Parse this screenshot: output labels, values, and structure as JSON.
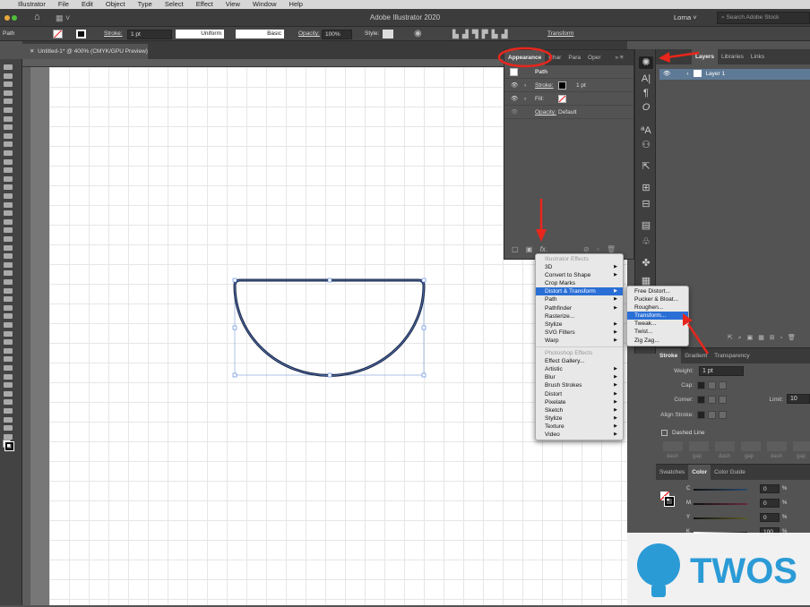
{
  "menubar": [
    "Illustrator",
    "File",
    "Edit",
    "Object",
    "Type",
    "Select",
    "Effect",
    "View",
    "Window",
    "Help"
  ],
  "title": "Adobe Illustrator 2020",
  "user": "Lorna",
  "search_placeholder": "Search Adobe Stock",
  "control": {
    "selection": "Path",
    "stroke_label": "Stroke:",
    "stroke_value": "1 pt",
    "profile": "Uniform",
    "brush": "Basic",
    "opacity_label": "Opacity:",
    "opacity_value": "100%",
    "style_label": "Style:",
    "transform": "Transform"
  },
  "doc_tab": "Untitled-1* @ 400% (CMYK/GPU Preview)",
  "appearance": {
    "tabs": [
      "Appearance",
      "Char",
      "Para",
      "Oper"
    ],
    "object": "Path",
    "stroke_label": "Stroke:",
    "stroke_value": "1 pt",
    "fill_label": "Fill:",
    "opacity_label": "Opacity:",
    "opacity_value": "Default"
  },
  "layers": {
    "tabs": [
      "Layers",
      "Libraries",
      "Links"
    ],
    "layer": "Layer 1"
  },
  "effects_menu": {
    "illustrator_header": "Illustrator Effects",
    "items": [
      {
        "label": "3D",
        "sub": true
      },
      {
        "label": "Convert to Shape",
        "sub": true
      },
      {
        "label": "Crop Marks",
        "sub": false
      },
      {
        "label": "Distort & Transform",
        "sub": true,
        "selected": true
      },
      {
        "label": "Path",
        "sub": true
      },
      {
        "label": "Pathfinder",
        "sub": true
      },
      {
        "label": "Rasterize...",
        "sub": false
      },
      {
        "label": "Stylize",
        "sub": true
      },
      {
        "label": "SVG Filters",
        "sub": true
      },
      {
        "label": "Warp",
        "sub": true
      }
    ],
    "photoshop_header": "Photoshop Effects",
    "ps_items": [
      {
        "label": "Effect Gallery...",
        "sub": false
      },
      {
        "label": "Artistic",
        "sub": true
      },
      {
        "label": "Blur",
        "sub": true
      },
      {
        "label": "Brush Strokes",
        "sub": true
      },
      {
        "label": "Distort",
        "sub": true
      },
      {
        "label": "Pixelate",
        "sub": true
      },
      {
        "label": "Sketch",
        "sub": true
      },
      {
        "label": "Stylize",
        "sub": true
      },
      {
        "label": "Texture",
        "sub": true
      },
      {
        "label": "Video",
        "sub": true
      }
    ]
  },
  "submenu": [
    "Free Distort...",
    "Pucker & Bloat...",
    "Roughen...",
    "Transform...",
    "Tweak...",
    "Twist...",
    "Zig Zag..."
  ],
  "submenu_selected": "Transform...",
  "stroke_panel": {
    "tabs": [
      "Stroke",
      "Gradient",
      "Transparency"
    ],
    "weight_label": "Weight:",
    "weight": "1 pt",
    "cap_label": "Cap:",
    "corner_label": "Corner:",
    "limit_label": "Limit:",
    "limit": "10",
    "align_label": "Align Stroke:",
    "dashed": "Dashed Line",
    "dash_labels": [
      "dash",
      "gap",
      "dash",
      "gap",
      "dash",
      "gap"
    ]
  },
  "color_panel": {
    "tabs": [
      "Swatches",
      "Color",
      "Color Guide"
    ],
    "channels": [
      {
        "name": "C",
        "value": "0"
      },
      {
        "name": "M",
        "value": "0"
      },
      {
        "name": "Y",
        "value": "0"
      },
      {
        "name": "K",
        "value": "100"
      }
    ],
    "unit": "%"
  },
  "watermark": "TWOS",
  "colors": {
    "annotation": "#e8261c",
    "selection": "#2a6fd6",
    "path": "#1b2a4a"
  }
}
